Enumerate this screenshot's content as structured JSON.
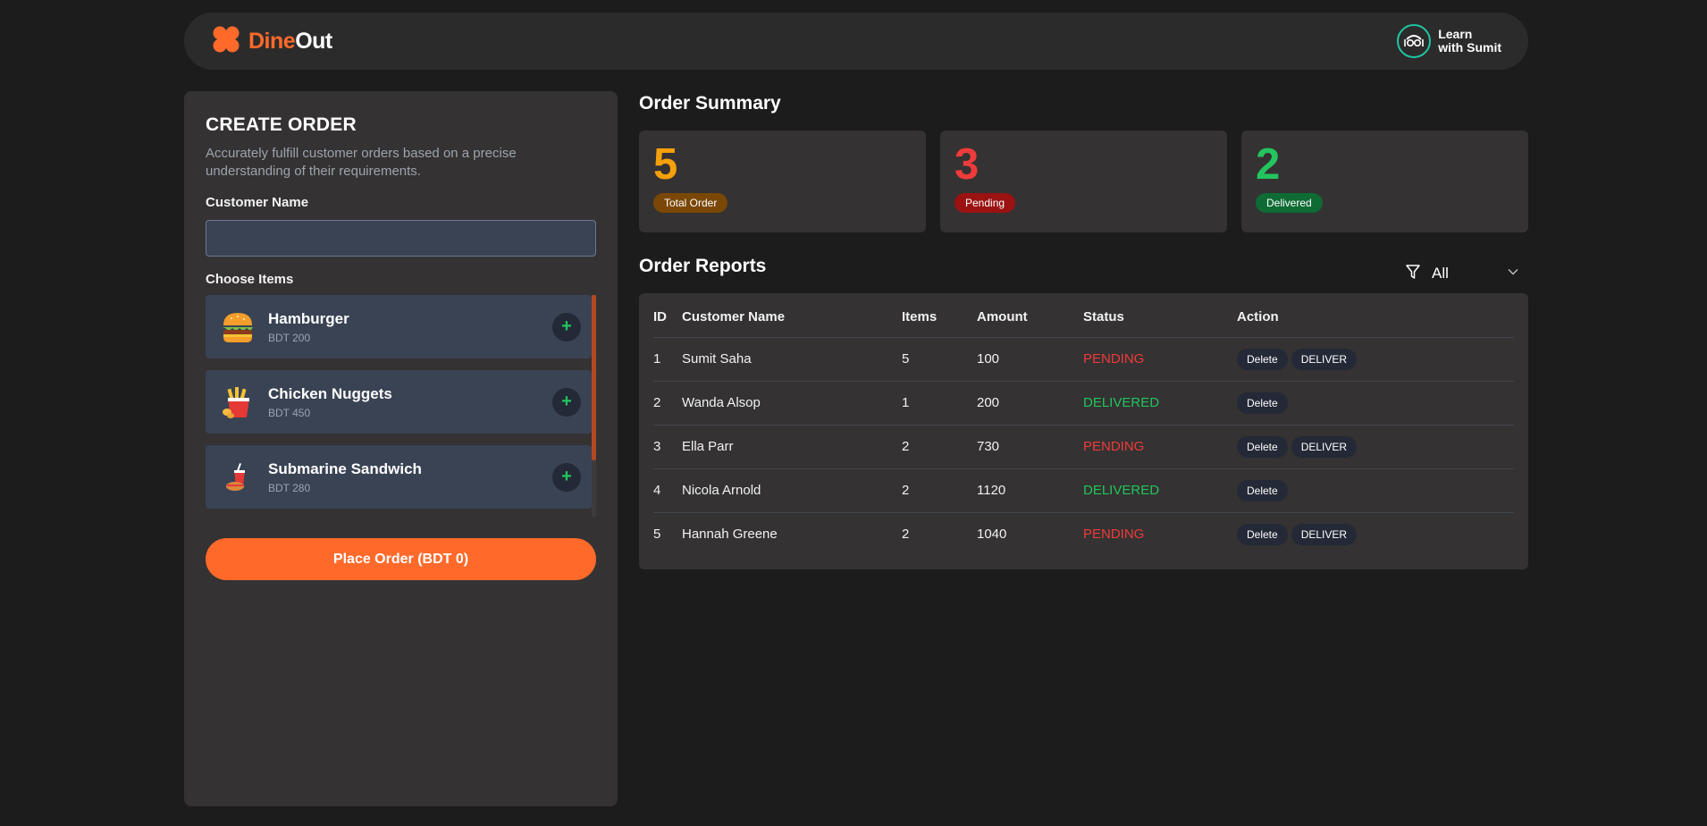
{
  "header": {
    "brand_part1": "Dine",
    "brand_part2": "Out",
    "partner_line1": "Learn",
    "partner_line2": "with Sumit"
  },
  "create_order": {
    "title": "CREATE ORDER",
    "description": "Accurately fulfill customer orders based on a precise understanding of their requirements.",
    "customer_label": "Customer Name",
    "customer_value": "",
    "items_label": "Choose Items",
    "items": [
      {
        "name": "Hamburger",
        "price": "BDT 200",
        "icon": "hamburger-icon"
      },
      {
        "name": "Chicken Nuggets",
        "price": "BDT 450",
        "icon": "chicken-nuggets-icon"
      },
      {
        "name": "Submarine Sandwich",
        "price": "BDT 280",
        "icon": "submarine-sandwich-icon"
      }
    ],
    "add_symbol": "+",
    "place_order_label": "Place Order (BDT 0)"
  },
  "summary": {
    "title": "Order Summary",
    "cards": [
      {
        "value": "5",
        "label": "Total Order",
        "color": "#f5a00b",
        "badge_bg": "#7a4706"
      },
      {
        "value": "3",
        "label": "Pending",
        "color": "#ef3b3b",
        "badge_bg": "#9b1212"
      },
      {
        "value": "2",
        "label": "Delivered",
        "color": "#22c55e",
        "badge_bg": "#0e6b34"
      }
    ]
  },
  "reports": {
    "title": "Order Reports",
    "filter_value": "All",
    "columns": [
      "ID",
      "Customer Name",
      "Items",
      "Amount",
      "Status",
      "Action"
    ],
    "rows": [
      {
        "id": "1",
        "name": "Sumit Saha",
        "items": "5",
        "amount": "100",
        "status": "PENDING"
      },
      {
        "id": "2",
        "name": "Wanda Alsop",
        "items": "1",
        "amount": "200",
        "status": "DELIVERED"
      },
      {
        "id": "3",
        "name": "Ella Parr",
        "items": "2",
        "amount": "730",
        "status": "PENDING"
      },
      {
        "id": "4",
        "name": "Nicola Arnold",
        "items": "2",
        "amount": "1120",
        "status": "DELIVERED"
      },
      {
        "id": "5",
        "name": "Hannah Greene",
        "items": "2",
        "amount": "1040",
        "status": "PENDING"
      }
    ],
    "delete_label": "Delete",
    "deliver_label": "DELIVER"
  },
  "colors": {
    "accent": "#ff6a2b",
    "background": "#1c1c1c",
    "panel": "#343232",
    "pending": "#ef3b3b",
    "delivered": "#22c55e"
  }
}
